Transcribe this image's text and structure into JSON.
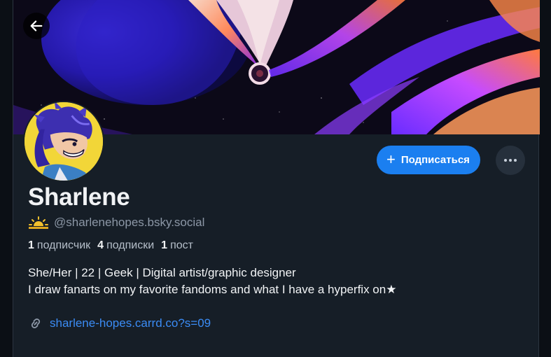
{
  "profile": {
    "display_name": "Sharlene",
    "handle": "@sharlenehopes.bsky.social",
    "handle_icon": "sunrise-emoji",
    "stats": {
      "followers_count": "1",
      "followers_label": "подписчик",
      "following_count": "4",
      "following_label": "подписки",
      "posts_count": "1",
      "posts_label": "пост"
    },
    "bio_line1": "She/Her | 22 | Geek | Digital artist/graphic designer",
    "bio_line2": "I draw fanarts on my favorite fandoms and what I have a hyperfix on★",
    "link_text": "sharlene-hopes.carrd.co?s=09"
  },
  "actions": {
    "follow_label": "Подписаться",
    "follow_icon": "plus-icon",
    "more_icon": "ellipsis-icon",
    "back_icon": "arrow-left-icon"
  },
  "colors": {
    "background": "#161e27",
    "accent": "#1b7ff0",
    "link": "#3b8cf5",
    "muted_text": "#8c97a6"
  }
}
